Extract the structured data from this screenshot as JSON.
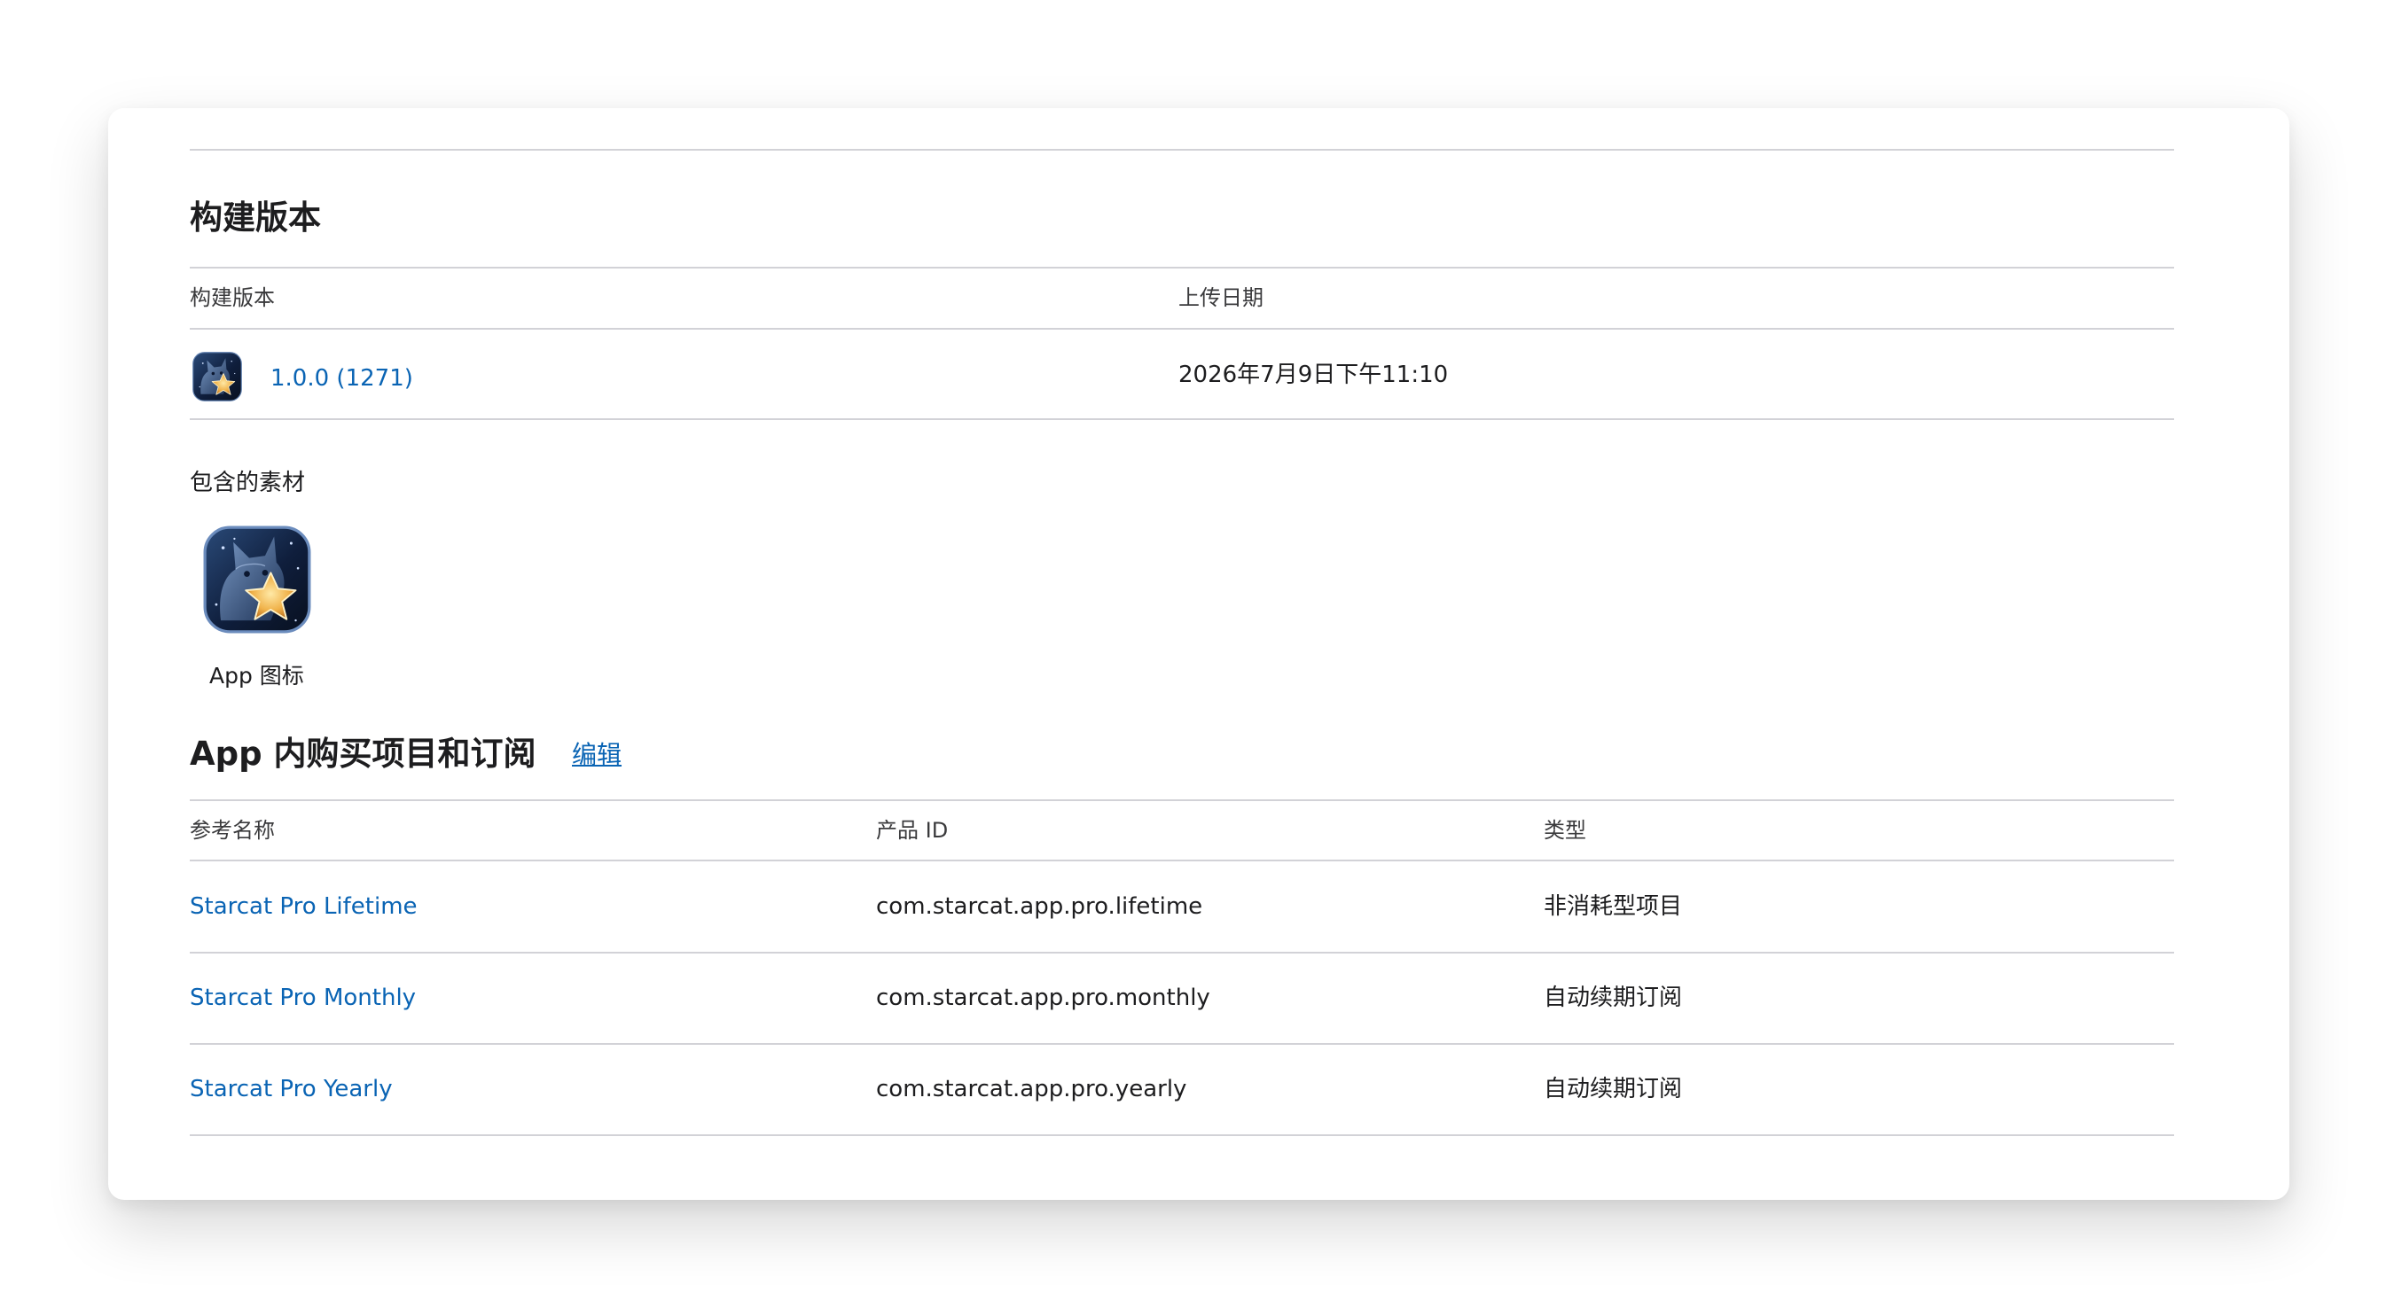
{
  "builds": {
    "section_title": "构建版本",
    "columns": {
      "build": "构建版本",
      "upload_date": "上传日期"
    },
    "rows": [
      {
        "version": "1.0.0 (1271)",
        "upload_date": "2026年7月9日下午11:10",
        "icon": "app-icon-cat-star"
      }
    ],
    "assets_heading": "包含的素材",
    "assets": [
      {
        "label": "App 图标",
        "icon": "app-icon-cat-star"
      }
    ]
  },
  "iap": {
    "section_title": "App 内购买项目和订阅",
    "edit_label": "编辑",
    "columns": {
      "reference_name": "参考名称",
      "product_id": "产品 ID",
      "type": "类型"
    },
    "rows": [
      {
        "reference_name": "Starcat Pro Lifetime",
        "product_id": "com.starcat.app.pro.lifetime",
        "type": "非消耗型项目"
      },
      {
        "reference_name": "Starcat Pro Monthly",
        "product_id": "com.starcat.app.pro.monthly",
        "type": "自动续期订阅"
      },
      {
        "reference_name": "Starcat Pro Yearly",
        "product_id": "com.starcat.app.pro.yearly",
        "type": "自动续期订阅"
      }
    ]
  },
  "colors": {
    "link": "#0a64b4",
    "divider": "#d2d2d7",
    "text": "#1d1d1f"
  }
}
